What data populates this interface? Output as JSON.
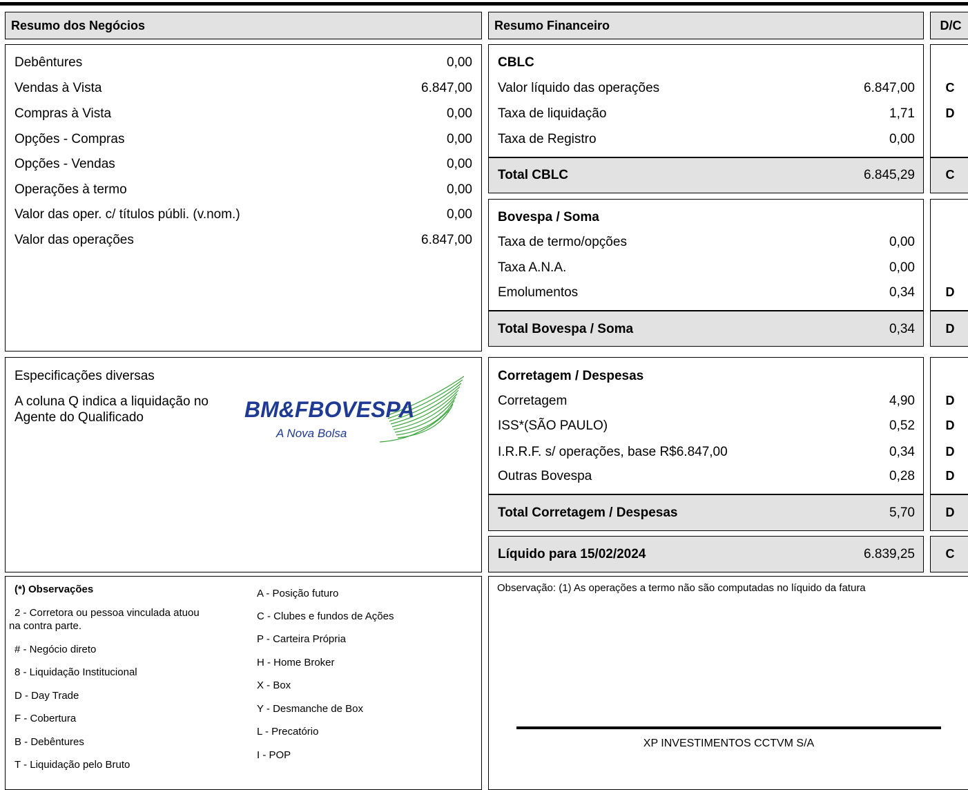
{
  "headers": {
    "resumo_negocios": "Resumo dos Negócios",
    "resumo_financeiro": "Resumo Financeiro",
    "dc": "D/C"
  },
  "negocios": [
    {
      "label": "Debêntures",
      "value": "0,00"
    },
    {
      "label": "Vendas à Vista",
      "value": "6.847,00"
    },
    {
      "label": "Compras à Vista",
      "value": "0,00"
    },
    {
      "label": "Opções - Compras",
      "value": "0,00"
    },
    {
      "label": "Opções - Vendas",
      "value": "0,00"
    },
    {
      "label": "Operações à termo",
      "value": "0,00"
    },
    {
      "label": "Valor das oper. c/ títulos públi. (v.nom.)",
      "value": "0,00"
    },
    {
      "label": "Valor das operações",
      "value": "6.847,00"
    }
  ],
  "especificacoes": {
    "title": "Especificações diversas",
    "line1": "A coluna Q indica a liquidação no",
    "line2": "Agente do Qualificado"
  },
  "logo": {
    "brand": "BM&FBOVESPA",
    "tagline": "A Nova Bolsa",
    "color": "#1f3a93",
    "accent": "#3aa63a"
  },
  "cblc": {
    "title": "CBLC",
    "rows": [
      {
        "label": "Valor líquido das operações",
        "value": "6.847,00",
        "dc": "C"
      },
      {
        "label": "Taxa de liquidação",
        "value": "1,71",
        "dc": "D"
      },
      {
        "label": "Taxa de Registro",
        "value": "0,00",
        "dc": ""
      }
    ],
    "total": {
      "label": "Total CBLC",
      "value": "6.845,29",
      "dc": "C"
    }
  },
  "bovespa": {
    "title": "Bovespa / Soma",
    "rows": [
      {
        "label": "Taxa de termo/opções",
        "value": "0,00",
        "dc": ""
      },
      {
        "label": "Taxa A.N.A.",
        "value": "0,00",
        "dc": ""
      },
      {
        "label": "Emolumentos",
        "value": "0,34",
        "dc": "D"
      }
    ],
    "total": {
      "label": "Total Bovespa / Soma",
      "value": "0,34",
      "dc": "D"
    }
  },
  "corretagem": {
    "title": "Corretagem / Despesas",
    "rows": [
      {
        "label": "Corretagem",
        "value": "4,90",
        "dc": "D"
      },
      {
        "label": "ISS*(SÃO PAULO)",
        "value": "0,52",
        "dc": "D"
      },
      {
        "label": "I.R.R.F. s/ operações, base R$6.847,00",
        "value": "0,34",
        "dc": "D"
      },
      {
        "label": "Outras Bovespa",
        "value": "0,28",
        "dc": "D"
      }
    ],
    "total": {
      "label": "Total Corretagem / Despesas",
      "value": "5,70",
      "dc": "D"
    }
  },
  "liquido": {
    "label": "Líquido para 15/02/2024",
    "value": "6.839,25",
    "dc": "C"
  },
  "observacoes": {
    "title": "(*) Observações",
    "left": [
      "2 - Corretora ou pessoa vinculada atuou",
      "na contra parte.",
      "# - Negócio direto",
      "8 - Liquidação Institucional",
      "D - Day Trade",
      "F - Cobertura",
      "B - Debêntures",
      "T - Liquidação pelo Bruto"
    ],
    "right": [
      "A - Posição futuro",
      "C - Clubes e fundos de Ações",
      "P - Carteira Própria",
      "H - Home Broker",
      "X - Box",
      "Y - Desmanche de Box",
      "L - Precatório",
      "I - POP"
    ]
  },
  "observacao_financeiro": "Observação: (1) As operações a termo não são computadas no líquido da fatura",
  "signature": "XP INVESTIMENTOS CCTVM S/A"
}
